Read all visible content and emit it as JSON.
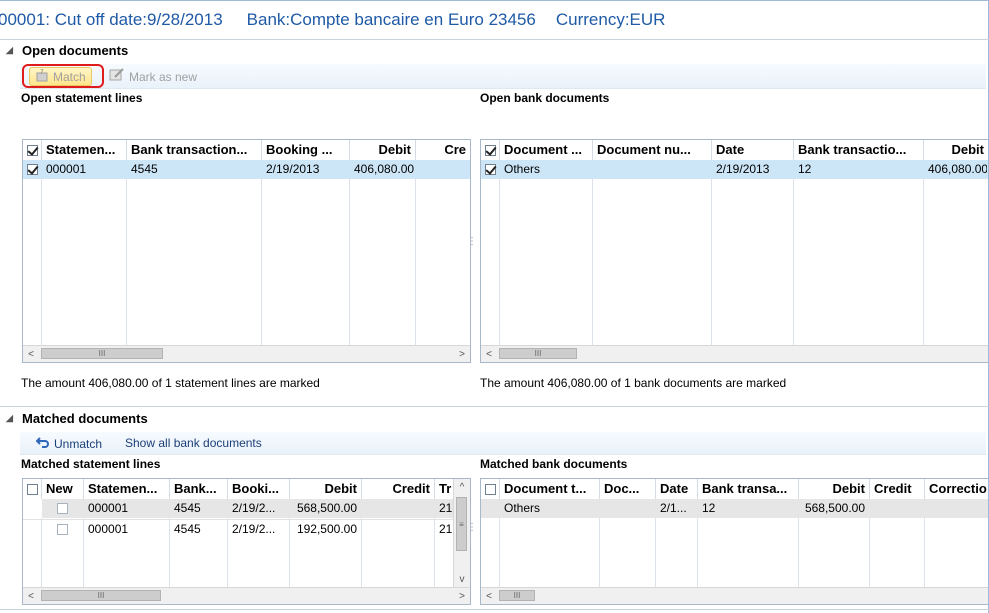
{
  "title": {
    "cutoff": "00001: Cut off date:9/28/2013",
    "bank": "Bank:Compte bancaire en Euro 23456",
    "currency": "Currency:EUR"
  },
  "open_section": {
    "heading": "Open documents",
    "toolbar": {
      "match_label": "Match",
      "mark_new_label": "Mark as new"
    },
    "statement": {
      "label": "Open statement lines",
      "columns": [
        "Statemen...",
        "Bank transaction...",
        "Booking ...",
        "Debit",
        "Cre"
      ],
      "rows": [
        {
          "checked": true,
          "statement": "000001",
          "bank_transaction": "4545",
          "booking": "2/19/2013",
          "debit": "406,080.00",
          "credit": ""
        }
      ],
      "status": "The amount 406,080.00 of 1 statement lines  are marked"
    },
    "bank": {
      "label": "Open bank documents",
      "columns": [
        "Document ...",
        "Document nu...",
        "Date",
        "Bank transactio...",
        "Debit"
      ],
      "rows": [
        {
          "checked": true,
          "document_type": "Others",
          "document_number": "",
          "date": "2/19/2013",
          "bank_transaction": "12",
          "debit": "406,080.00"
        }
      ],
      "status": "The amount 406,080.00 of 1 bank documents are marked"
    }
  },
  "matched_section": {
    "heading": "Matched documents",
    "toolbar": {
      "unmatch_label": "Unmatch",
      "show_all_label": "Show all bank documents"
    },
    "statement": {
      "label": "Matched statement lines",
      "columns": [
        "New",
        "Statemen...",
        "Bank...",
        "Booki...",
        "Debit",
        "Credit",
        "Tr"
      ],
      "rows": [
        {
          "new": false,
          "statement": "000001",
          "bank": "4545",
          "booking": "2/19/2...",
          "debit": "568,500.00",
          "credit": "",
          "tr": "21"
        },
        {
          "new": false,
          "statement": "000001",
          "bank": "4545",
          "booking": "2/19/2...",
          "debit": "192,500.00",
          "credit": "",
          "tr": "21"
        }
      ]
    },
    "bank": {
      "label": "Matched bank documents",
      "columns": [
        "Document t...",
        "Doc...",
        "Date",
        "Bank transa...",
        "Debit",
        "Credit",
        "Correctio"
      ],
      "rows": [
        {
          "document_type": "Others",
          "doc": "",
          "date": "2/1...",
          "bank_transaction": "12",
          "debit": "568,500.00",
          "credit": "",
          "correction": ""
        }
      ]
    }
  },
  "icons": {
    "match": "match-icon",
    "mark_new": "mark-as-new-icon",
    "unmatch": "unmatch-icon",
    "collapse": "collapse-triangle-icon"
  },
  "colors": {
    "title_text": "#1f5aa6",
    "selected_row": "#cde6f7",
    "highlight_border": "#e01b1b"
  }
}
